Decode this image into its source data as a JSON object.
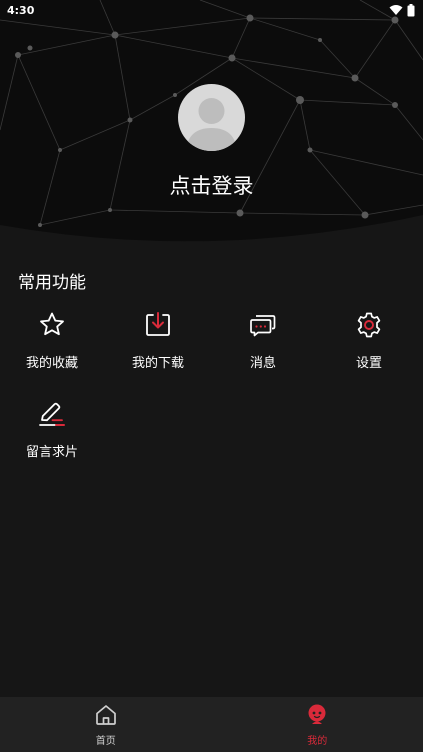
{
  "status_bar": {
    "time": "4:30"
  },
  "profile": {
    "login_label": "点击登录"
  },
  "common_functions": {
    "title": "常用功能",
    "items": [
      {
        "label": "我的收藏",
        "icon": "star-icon"
      },
      {
        "label": "我的下载",
        "icon": "download-icon"
      },
      {
        "label": "消息",
        "icon": "message-icon"
      },
      {
        "label": "设置",
        "icon": "gear-icon"
      },
      {
        "label": "留言求片",
        "icon": "edit-icon"
      }
    ]
  },
  "bottom_nav": {
    "items": [
      {
        "label": "首页",
        "icon": "home-icon",
        "active": false
      },
      {
        "label": "我的",
        "icon": "profile-icon",
        "active": true
      }
    ]
  },
  "colors": {
    "background": "#161616",
    "header_background": "#0e0e0e",
    "accent": "#d92a3a",
    "nav_background": "#222222",
    "text": "#ffffff"
  }
}
